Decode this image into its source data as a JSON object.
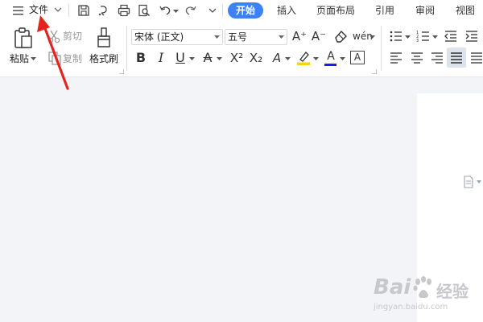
{
  "titlebar": {
    "file_label": "文件",
    "tabs": [
      {
        "label": "开始",
        "active": true
      },
      {
        "label": "插入",
        "active": false
      },
      {
        "label": "页面布局",
        "active": false
      },
      {
        "label": "引用",
        "active": false
      },
      {
        "label": "审阅",
        "active": false
      },
      {
        "label": "视图",
        "active": false
      }
    ],
    "quick_access_icons": [
      "save-icon",
      "reformat-icon",
      "print-icon",
      "print-preview-icon",
      "undo-icon",
      "redo-icon",
      "customize-icon"
    ]
  },
  "ribbon": {
    "clipboard": {
      "paste_label": "粘贴",
      "cut_label": "剪切",
      "copy_label": "复制",
      "format_painter_label": "格式刷"
    },
    "font": {
      "font_name": "宋体 (正文)",
      "font_size": "五号",
      "phonetic_glyph": "wén",
      "bold_glyph": "B",
      "italic_glyph": "I",
      "underline_glyph": "U",
      "strike_glyph": "A",
      "superscript_glyph": "X²",
      "subscript_glyph": "X₂",
      "text_effect_glyph": "A",
      "font_color_glyph": "A",
      "char_border_glyph": "A",
      "grow_glyph": "A⁺",
      "shrink_glyph": "A⁻",
      "highlight_color": "#f5d800",
      "font_color": "#1a1aff"
    },
    "paragraph": {
      "alignment_active": "justify"
    }
  },
  "watermark": {
    "brand": "Bai",
    "brand_suffix": "经验",
    "url": "jingyan.baidu.com"
  },
  "annotation": {
    "arrow_color": "#e5231d"
  }
}
